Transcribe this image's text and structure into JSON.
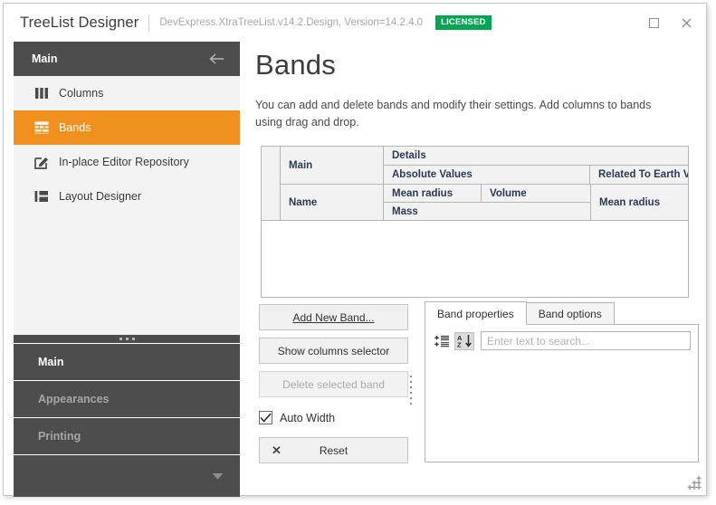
{
  "titlebar": {
    "app_title": "TreeList Designer",
    "assembly_info": "DevExpress.XtraTreeList.v14.2.Design, Version=14.2.4.0",
    "license_badge": "LICENSED",
    "license_color": "#00a650",
    "maximize_icon": "maximize-icon",
    "close_icon": "close-icon"
  },
  "sidebar": {
    "header_label": "Main",
    "back_icon": "back-arrow-icon",
    "accent_color": "#f0901e",
    "dark_color": "#4d4d4d",
    "nav_items": [
      {
        "label": "Columns",
        "icon": "columns-icon",
        "active": false
      },
      {
        "label": "Bands",
        "icon": "bands-grid-icon",
        "active": true
      },
      {
        "label": "In-place Editor Repository",
        "icon": "editor-pencil-icon",
        "active": false
      },
      {
        "label": "Layout Designer",
        "icon": "layout-blocks-icon",
        "active": false
      }
    ],
    "groups": [
      {
        "label": "Main",
        "selected": true
      },
      {
        "label": "Appearances",
        "selected": false
      },
      {
        "label": "Printing",
        "selected": false
      }
    ],
    "more_icon": "chevron-down-icon"
  },
  "page": {
    "title": "Bands",
    "description": "You can add and delete bands and modify their settings. Add columns to bands using drag and drop."
  },
  "band_grid": {
    "row1": {
      "main_band": "Main",
      "details_band": "Details",
      "absolute_values_band": "Absolute Values",
      "related_to_earth_band": "Related To Earth Values"
    },
    "row2": {
      "name_band": "Name",
      "mean_radius": "Mean radius",
      "volume": "Volume",
      "mass": "Mass",
      "related_mean_radius": "Mean radius"
    }
  },
  "buttons": {
    "add_new_band": "Add New Band...",
    "show_columns_selector": "Show columns selector",
    "delete_selected_band": "Delete selected band",
    "delete_enabled": false,
    "auto_width_label": "Auto Width",
    "auto_width_checked": true,
    "reset": "Reset",
    "reset_icon": "close-x-icon"
  },
  "properties_panel": {
    "tabs": [
      {
        "label": "Band properties",
        "active": true
      },
      {
        "label": "Band options",
        "active": false
      }
    ],
    "toolbar": [
      {
        "icon": "categorized-icon",
        "pressed": false
      },
      {
        "icon": "alphabetical-sort-icon",
        "pressed": true
      }
    ],
    "search_placeholder": "Enter text to search...",
    "search_value": ""
  },
  "resize_grip_icon": "resize-grip-icon"
}
